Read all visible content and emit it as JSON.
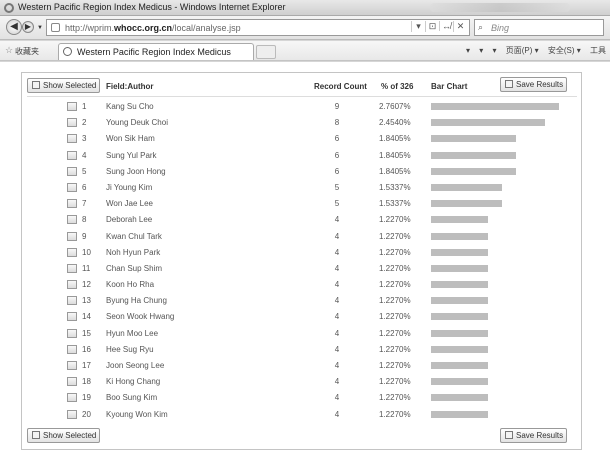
{
  "window": {
    "title": "Western Pacific Region Index Medicus - Windows Internet Explorer"
  },
  "address_bar": {
    "url_prefix": "http://",
    "url_sub": "wprim.",
    "url_domain": "whocc.org.cn",
    "url_path": "/local/analyse.jsp",
    "tool_icons": [
      "▾",
      "⊡",
      "↮",
      "✕"
    ]
  },
  "search": {
    "placeholder": "Bing"
  },
  "favorites_bar": {
    "label": "收藏夹",
    "tab_title": "Western Pacific Region Index Medicus",
    "commands": [
      "▾",
      "▾",
      "▾",
      "页面(P) ▾",
      "安全(S) ▾",
      "工具"
    ]
  },
  "buttons": {
    "show_selected": "Show Selected",
    "save_results": "Save Results"
  },
  "table": {
    "headers": {
      "field": "Field:Author",
      "count": "Record Count",
      "pct": "% of 326",
      "bar": "Bar Chart"
    },
    "max_count": 9,
    "rows": [
      {
        "rank": "1",
        "name": "Kang Su Cho",
        "count": 9,
        "pct": "2.7607%"
      },
      {
        "rank": "2",
        "name": "Young Deuk Choi",
        "count": 8,
        "pct": "2.4540%"
      },
      {
        "rank": "3",
        "name": "Won Sik Ham",
        "count": 6,
        "pct": "1.8405%"
      },
      {
        "rank": "4",
        "name": "Sung Yul Park",
        "count": 6,
        "pct": "1.8405%"
      },
      {
        "rank": "5",
        "name": "Sung Joon Hong",
        "count": 6,
        "pct": "1.8405%"
      },
      {
        "rank": "6",
        "name": "Ji Young Kim",
        "count": 5,
        "pct": "1.5337%"
      },
      {
        "rank": "7",
        "name": "Won Jae Lee",
        "count": 5,
        "pct": "1.5337%"
      },
      {
        "rank": "8",
        "name": "Deborah Lee",
        "count": 4,
        "pct": "1.2270%"
      },
      {
        "rank": "9",
        "name": "Kwan Chul Tark",
        "count": 4,
        "pct": "1.2270%"
      },
      {
        "rank": "10",
        "name": "Noh Hyun Park",
        "count": 4,
        "pct": "1.2270%"
      },
      {
        "rank": "11",
        "name": "Chan Sup Shim",
        "count": 4,
        "pct": "1.2270%"
      },
      {
        "rank": "12",
        "name": "Koon Ho Rha",
        "count": 4,
        "pct": "1.2270%"
      },
      {
        "rank": "13",
        "name": "Byung Ha Chung",
        "count": 4,
        "pct": "1.2270%"
      },
      {
        "rank": "14",
        "name": "Seon Wook Hwang",
        "count": 4,
        "pct": "1.2270%"
      },
      {
        "rank": "15",
        "name": "Hyun Moo Lee",
        "count": 4,
        "pct": "1.2270%"
      },
      {
        "rank": "16",
        "name": "Hee Sug Ryu",
        "count": 4,
        "pct": "1.2270%"
      },
      {
        "rank": "17",
        "name": "Joon Seong Lee",
        "count": 4,
        "pct": "1.2270%"
      },
      {
        "rank": "18",
        "name": "Ki Hong Chang",
        "count": 4,
        "pct": "1.2270%"
      },
      {
        "rank": "19",
        "name": "Boo Sung Kim",
        "count": 4,
        "pct": "1.2270%"
      },
      {
        "rank": "20",
        "name": "Kyoung Won Kim",
        "count": 4,
        "pct": "1.2270%"
      }
    ]
  },
  "colors": {
    "bar_fill": "#bdbdbd",
    "panel_border": "#c4c4c4"
  }
}
